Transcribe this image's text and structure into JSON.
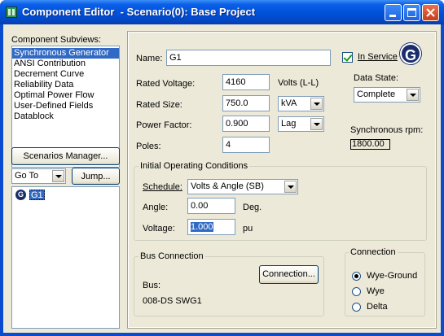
{
  "window": {
    "title": "Component Editor  - Scenario(0): Base Project",
    "minimize_icon": "minimize-icon",
    "maximize_icon": "maximize-icon",
    "close_icon": "close-icon"
  },
  "left_panel": {
    "subviews_label": "Component Subviews:",
    "subviews": [
      {
        "label": "Synchronous Generator",
        "selected": true
      },
      {
        "label": "ANSI Contribution",
        "selected": false
      },
      {
        "label": "Decrement Curve",
        "selected": false
      },
      {
        "label": "Reliability Data",
        "selected": false
      },
      {
        "label": "Optimal Power Flow",
        "selected": false
      },
      {
        "label": "User-Defined Fields",
        "selected": false
      },
      {
        "label": "Datablock",
        "selected": false
      }
    ],
    "scenarios_button": "Scenarios Manager...",
    "goto_value": "Go To",
    "jump_button": "Jump...",
    "tree_item": {
      "label": "G1",
      "icon": "generator-icon"
    }
  },
  "editor": {
    "name_label": "Name:",
    "name_value": "G1",
    "in_service_label": "In Service",
    "in_service_checked": true,
    "generator_badge": "G",
    "rated_voltage_label": "Rated Voltage:",
    "rated_voltage_value": "4160",
    "voltage_unit": "Volts (L-L)",
    "rated_size_label": "Rated Size:",
    "rated_size_value": "750.0",
    "size_unit": "kVA",
    "power_factor_label": "Power Factor:",
    "power_factor_value": "0.900",
    "pf_mode": "Lag",
    "poles_label": "Poles:",
    "poles_value": "4",
    "data_state_label": "Data State:",
    "data_state_value": "Complete",
    "sync_rpm_label": "Synchronous rpm:",
    "sync_rpm_value": "1800.00",
    "initial_conditions": {
      "group_label": "Initial Operating Conditions",
      "schedule_label": "Schedule:",
      "schedule_value": "Volts & Angle (SB)",
      "angle_label": "Angle:",
      "angle_value": "0.00",
      "angle_unit": "Deg.",
      "voltage_label": "Voltage:",
      "voltage_value": "1.000",
      "voltage_unit": "pu"
    },
    "bus_connection": {
      "group_label": "Bus Connection",
      "connection_button": "Connection...",
      "bus_label": "Bus:",
      "bus_value": "008-DS SWG1"
    },
    "connection": {
      "group_label": "Connection",
      "options": [
        {
          "label": "Wye-Ground",
          "selected": true
        },
        {
          "label": "Wye",
          "selected": false
        },
        {
          "label": "Delta",
          "selected": false
        }
      ]
    }
  }
}
